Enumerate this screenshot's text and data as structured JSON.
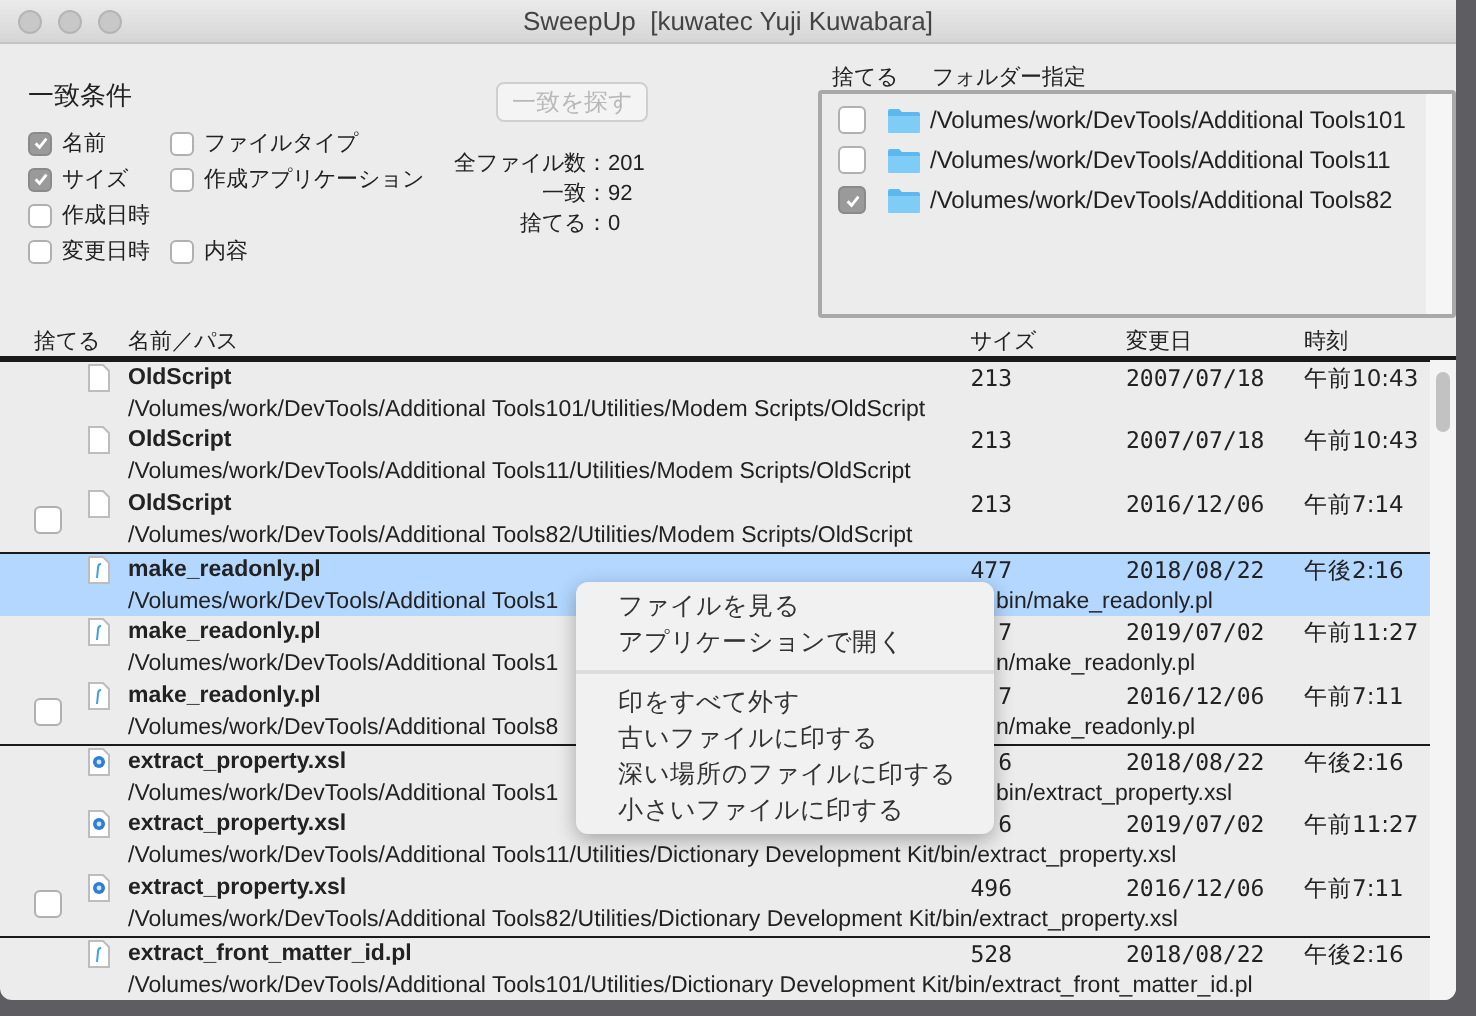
{
  "window": {
    "title": "SweepUp  [kuwatec Yuji Kuwabara]"
  },
  "criteria": {
    "title": "一致条件",
    "options": [
      {
        "label": "名前",
        "checked": true
      },
      {
        "label": "ファイルタイプ",
        "checked": false
      },
      {
        "label": "サイズ",
        "checked": true
      },
      {
        "label": "作成アプリケーション",
        "checked": false
      },
      {
        "label": "作成日時",
        "checked": false
      },
      {
        "label": "変更日時",
        "checked": false
      },
      {
        "label": "内容",
        "checked": false
      }
    ]
  },
  "find_button": {
    "label": "一致を探す",
    "disabled": true
  },
  "stats": [
    {
      "label": "全ファイル数：",
      "value": "201"
    },
    {
      "label": "一致：",
      "value": "92"
    },
    {
      "label": "捨てる：",
      "value": "0"
    }
  ],
  "folders": {
    "columns": [
      "捨てる",
      "フォルダー指定"
    ],
    "items": [
      {
        "path": "/Volumes/work/DevTools/Additional Tools101",
        "checked": false
      },
      {
        "path": "/Volumes/work/DevTools/Additional Tools11",
        "checked": false
      },
      {
        "path": "/Volumes/work/DevTools/Additional Tools82",
        "checked": true
      }
    ]
  },
  "table": {
    "columns": [
      "捨てる",
      "名前／パス",
      "サイズ",
      "変更日",
      "時刻"
    ],
    "rows": [
      {
        "kind": "document",
        "group_start": true,
        "selected": false,
        "name": "OldScript",
        "path": "/Volumes/work/DevTools/Additional Tools101/Utilities/Modem Scripts/OldScript",
        "size": "213",
        "date": "2007/07/18",
        "time": "午前10:43"
      },
      {
        "kind": "document",
        "group_start": false,
        "selected": false,
        "name": "OldScript",
        "path": "/Volumes/work/DevTools/Additional Tools11/Utilities/Modem Scripts/OldScript",
        "size": "213",
        "date": "2007/07/18",
        "time": "午前10:43"
      },
      {
        "kind": "document",
        "group_start": false,
        "selected": false,
        "checked": false,
        "name": "OldScript",
        "path": "/Volumes/work/DevTools/Additional Tools82/Utilities/Modem Scripts/OldScript",
        "size": "213",
        "date": "2016/12/06",
        "time": "午前7:14"
      },
      {
        "kind": "script",
        "group_start": true,
        "selected": true,
        "name": "make_readonly.pl",
        "path": "/Volumes/work/DevTools/Additional Tools1",
        "path_tail": "bin/make_readonly.pl",
        "size": "477",
        "date": "2018/08/22",
        "time": "午後2:16"
      },
      {
        "kind": "script",
        "group_start": false,
        "selected": false,
        "name": "make_readonly.pl",
        "path": "/Volumes/work/DevTools/Additional Tools1",
        "path_tail": "n/make_readonly.pl",
        "size": "7",
        "date": "2019/07/02",
        "time": "午前11:27"
      },
      {
        "kind": "script",
        "group_start": false,
        "selected": false,
        "checked": false,
        "name": "make_readonly.pl",
        "path": "/Volumes/work/DevTools/Additional Tools8",
        "path_tail": "n/make_readonly.pl",
        "size": "7",
        "date": "2016/12/06",
        "time": "午前7:11"
      },
      {
        "kind": "stylesheet",
        "group_start": true,
        "selected": false,
        "name": "extract_property.xsl",
        "path": "/Volumes/work/DevTools/Additional Tools1",
        "path_tail": "bin/extract_property.xsl",
        "size": "6",
        "date": "2018/08/22",
        "time": "午後2:16"
      },
      {
        "kind": "stylesheet",
        "group_start": false,
        "selected": false,
        "name": "extract_property.xsl",
        "path": "/Volumes/work/DevTools/Additional Tools11/Utilities/Dictionary Development Kit/bin/extract_property.xsl",
        "size": "6",
        "date": "2019/07/02",
        "time": "午前11:27"
      },
      {
        "kind": "stylesheet",
        "group_start": false,
        "selected": false,
        "checked": false,
        "name": "extract_property.xsl",
        "path": "/Volumes/work/DevTools/Additional Tools82/Utilities/Dictionary Development Kit/bin/extract_property.xsl",
        "size": "496",
        "date": "2016/12/06",
        "time": "午前7:11"
      },
      {
        "kind": "script",
        "group_start": true,
        "selected": false,
        "name": "extract_front_matter_id.pl",
        "path": "/Volumes/work/DevTools/Additional Tools101/Utilities/Dictionary Development Kit/bin/extract_front_matter_id.pl",
        "size": "528",
        "date": "2018/08/22",
        "time": "午後2:16"
      }
    ]
  },
  "context_menu": {
    "items": [
      {
        "kind": "item",
        "label": "ファイルを見る"
      },
      {
        "kind": "item",
        "label": "アプリケーションで開く"
      },
      {
        "kind": "separator"
      },
      {
        "kind": "item",
        "label": "印をすべて外す"
      },
      {
        "kind": "item",
        "label": "古いファイルに印する"
      },
      {
        "kind": "item",
        "label": "深い場所のファイルに印する"
      },
      {
        "kind": "item",
        "label": "小さいファイルに印する"
      }
    ]
  }
}
